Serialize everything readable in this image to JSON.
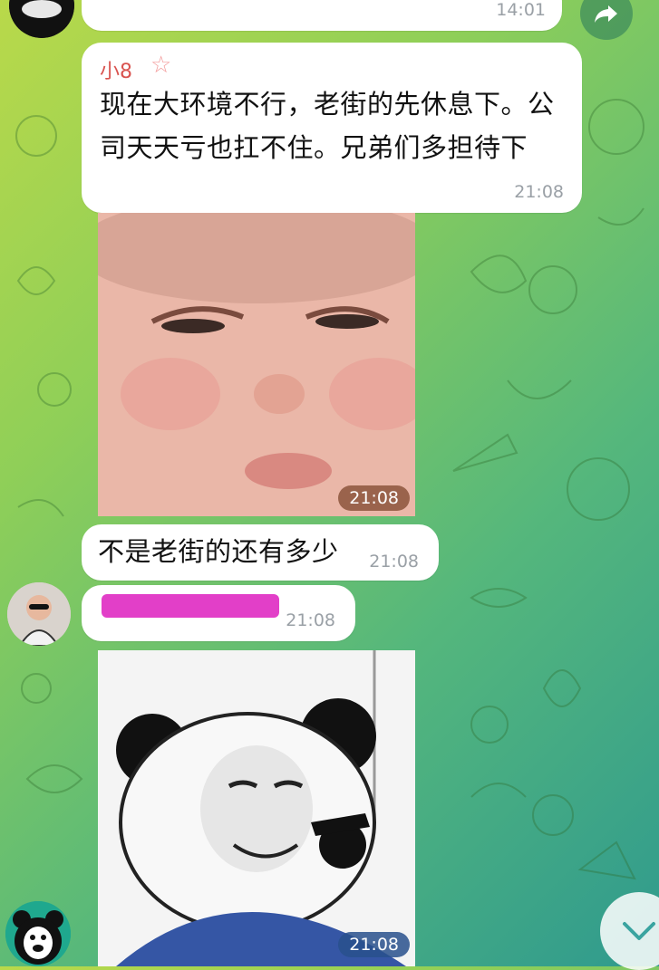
{
  "chat": {
    "top_message": {
      "time": "14:01"
    },
    "message1": {
      "sender": "小8",
      "text": "现在大环境不行，老街的先休息下。公司天天亏也扛不住。兄弟们多担待下",
      "time": "21:08"
    },
    "image1": {
      "time": "21:08"
    },
    "message2": {
      "text": "不是老街的还有多少",
      "time": "21:08"
    },
    "message3": {
      "time": "21:08"
    },
    "image2": {
      "time": "21:08"
    }
  },
  "icons": {
    "forward": "forward-arrow-icon",
    "scroll_down": "chevron-down-icon",
    "sender_badge": "star-icon"
  },
  "colors": {
    "sender_name": "#d9534f",
    "redaction": "#e23fc8"
  }
}
